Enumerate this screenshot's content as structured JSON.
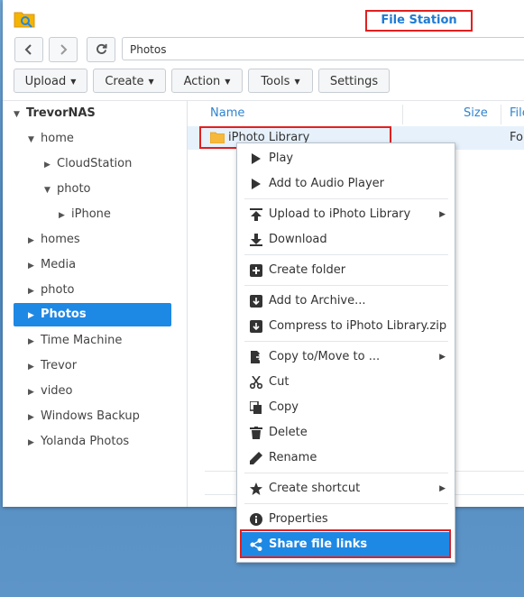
{
  "window": {
    "title": "File Station"
  },
  "nav": {
    "back_icon": "chevron-left-icon",
    "forward_icon": "chevron-right-icon",
    "refresh_icon": "refresh-icon",
    "path": "Photos"
  },
  "toolbar": {
    "upload": "Upload",
    "create": "Create",
    "action": "Action",
    "tools": "Tools",
    "settings": "Settings"
  },
  "tree": {
    "root": "TrevorNAS",
    "items": [
      "home",
      "CloudStation",
      "photo",
      "iPhone",
      "homes",
      "Media",
      "photo",
      "Photos",
      "Time Machine",
      "Trevor",
      "video",
      "Windows Backup",
      "Yolanda Photos"
    ],
    "selected": "Photos"
  },
  "list": {
    "columns": [
      "Name",
      "Size",
      "File"
    ],
    "rows": [
      {
        "name": "iPhoto Library",
        "size": "",
        "type": "Fol"
      }
    ]
  },
  "context_menu": {
    "items": [
      {
        "label": "Play",
        "icon": "play-icon"
      },
      {
        "label": "Add to Audio Player",
        "icon": "play-icon"
      },
      {
        "label": "Upload to iPhoto Library",
        "icon": "upload-icon",
        "submenu": true
      },
      {
        "label": "Download",
        "icon": "download-icon"
      },
      {
        "label": "Create folder",
        "icon": "plus-icon"
      },
      {
        "label": "Add to Archive...",
        "icon": "archive-icon"
      },
      {
        "label": "Compress to iPhoto Library.zip",
        "icon": "compress-icon"
      },
      {
        "label": "Copy to/Move to ...",
        "icon": "copy-move-icon",
        "submenu": true
      },
      {
        "label": "Cut",
        "icon": "scissors-icon"
      },
      {
        "label": "Copy",
        "icon": "copy-icon"
      },
      {
        "label": "Delete",
        "icon": "trash-icon"
      },
      {
        "label": "Rename",
        "icon": "pencil-icon"
      },
      {
        "label": "Create shortcut",
        "icon": "star-icon",
        "submenu": true
      },
      {
        "label": "Properties",
        "icon": "info-icon"
      },
      {
        "label": "Share file links",
        "icon": "share-icon",
        "active": true
      }
    ]
  },
  "colors": {
    "accent": "#1e88e5",
    "highlight_border": "#e02020",
    "title_text": "#1e7bd3"
  }
}
